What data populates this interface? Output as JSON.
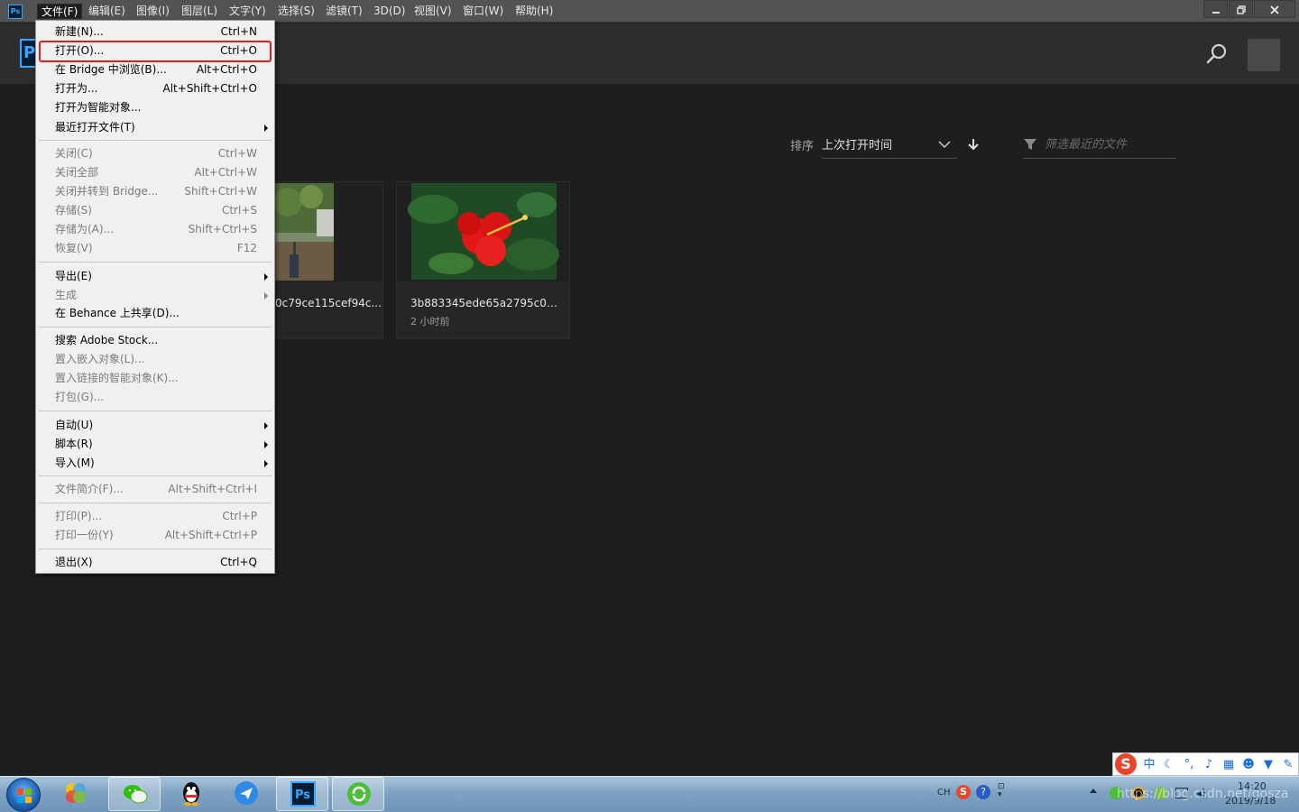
{
  "menubar": {
    "app_icon": "ps-app-icon",
    "items": [
      {
        "label": "文件(F)",
        "active": true
      },
      {
        "label": "编辑(E)"
      },
      {
        "label": "图像(I)"
      },
      {
        "label": "图层(L)"
      },
      {
        "label": "文字(Y)"
      },
      {
        "label": "选择(S)"
      },
      {
        "label": "滤镜(T)"
      },
      {
        "label": "3D(D)"
      },
      {
        "label": "视图(V)"
      },
      {
        "label": "窗口(W)"
      },
      {
        "label": "帮助(H)"
      }
    ],
    "window_buttons": [
      "minimize-icon",
      "restore-icon",
      "close-icon"
    ]
  },
  "home": {
    "logo_text": "P",
    "sort_label": "排序",
    "sort_value": "上次打开时间",
    "filter_placeholder": "筛选最近的文件"
  },
  "recent_files": [
    {
      "name": "0c79ce115cef94c...",
      "time": ""
    },
    {
      "name": "3b883345ede65a2795c0a...",
      "time": "2 小时前"
    }
  ],
  "file_menu": {
    "groups": [
      [
        {
          "label": "新建(N)...",
          "shortcut": "Ctrl+N",
          "enabled": true
        },
        {
          "label": "打开(O)...",
          "shortcut": "Ctrl+O",
          "enabled": true,
          "highlighted": true
        },
        {
          "label": "在 Bridge 中浏览(B)...",
          "shortcut": "Alt+Ctrl+O",
          "enabled": true
        },
        {
          "label": "打开为...",
          "shortcut": "Alt+Shift+Ctrl+O",
          "enabled": true
        },
        {
          "label": "打开为智能对象...",
          "shortcut": "",
          "enabled": true
        },
        {
          "label": "最近打开文件(T)",
          "shortcut": "",
          "enabled": true,
          "submenu": true
        }
      ],
      [
        {
          "label": "关闭(C)",
          "shortcut": "Ctrl+W",
          "enabled": false
        },
        {
          "label": "关闭全部",
          "shortcut": "Alt+Ctrl+W",
          "enabled": false
        },
        {
          "label": "关闭并转到 Bridge...",
          "shortcut": "Shift+Ctrl+W",
          "enabled": false
        },
        {
          "label": "存储(S)",
          "shortcut": "Ctrl+S",
          "enabled": false
        },
        {
          "label": "存储为(A)...",
          "shortcut": "Shift+Ctrl+S",
          "enabled": false
        },
        {
          "label": "恢复(V)",
          "shortcut": "F12",
          "enabled": false
        }
      ],
      [
        {
          "label": "导出(E)",
          "shortcut": "",
          "enabled": true,
          "submenu": true
        },
        {
          "label": "生成",
          "shortcut": "",
          "enabled": false,
          "submenu": true
        },
        {
          "label": "在 Behance 上共享(D)...",
          "shortcut": "",
          "enabled": true
        }
      ],
      [
        {
          "label": "搜索 Adobe Stock...",
          "shortcut": "",
          "enabled": true
        },
        {
          "label": "置入嵌入对象(L)...",
          "shortcut": "",
          "enabled": false
        },
        {
          "label": "置入链接的智能对象(K)...",
          "shortcut": "",
          "enabled": false
        },
        {
          "label": "打包(G)...",
          "shortcut": "",
          "enabled": false
        }
      ],
      [
        {
          "label": "自动(U)",
          "shortcut": "",
          "enabled": true,
          "submenu": true
        },
        {
          "label": "脚本(R)",
          "shortcut": "",
          "enabled": true,
          "submenu": true
        },
        {
          "label": "导入(M)",
          "shortcut": "",
          "enabled": true,
          "submenu": true
        }
      ],
      [
        {
          "label": "文件简介(F)...",
          "shortcut": "Alt+Shift+Ctrl+I",
          "enabled": false
        }
      ],
      [
        {
          "label": "打印(P)...",
          "shortcut": "Ctrl+P",
          "enabled": false
        },
        {
          "label": "打印一份(Y)",
          "shortcut": "Alt+Shift+Ctrl+P",
          "enabled": false
        }
      ],
      [
        {
          "label": "退出(X)",
          "shortcut": "Ctrl+Q",
          "enabled": true
        }
      ]
    ]
  },
  "taskbar": {
    "apps": [
      {
        "name": "start-orb-icon"
      },
      {
        "name": "colorful-app-icon"
      },
      {
        "name": "wechat-icon",
        "open": true
      },
      {
        "name": "qq-penguin-icon"
      },
      {
        "name": "feishu-bird-icon"
      },
      {
        "name": "photoshop-icon",
        "open": true
      },
      {
        "name": "green-refresh-app-icon",
        "open": true
      }
    ],
    "tray": {
      "lang": "CH",
      "time": "14:20",
      "date": "2019/9/18",
      "watermark": "https://blog.csdn.net/gosza"
    },
    "ime_bar": {
      "icons": [
        "sogou-s-icon",
        "chinese-mode-icon",
        "moon-icon",
        "punctuation-icon",
        "microphone-icon",
        "keyboard-icon",
        "user-icon",
        "shirt-icon",
        "wrench-icon"
      ],
      "mode_label": "中"
    }
  },
  "colors": {
    "background": "#1e1e1e",
    "menu_bg": "#f0f0f0",
    "highlight_border": "#e31b1b",
    "ps_blue": "#31a8ff"
  }
}
